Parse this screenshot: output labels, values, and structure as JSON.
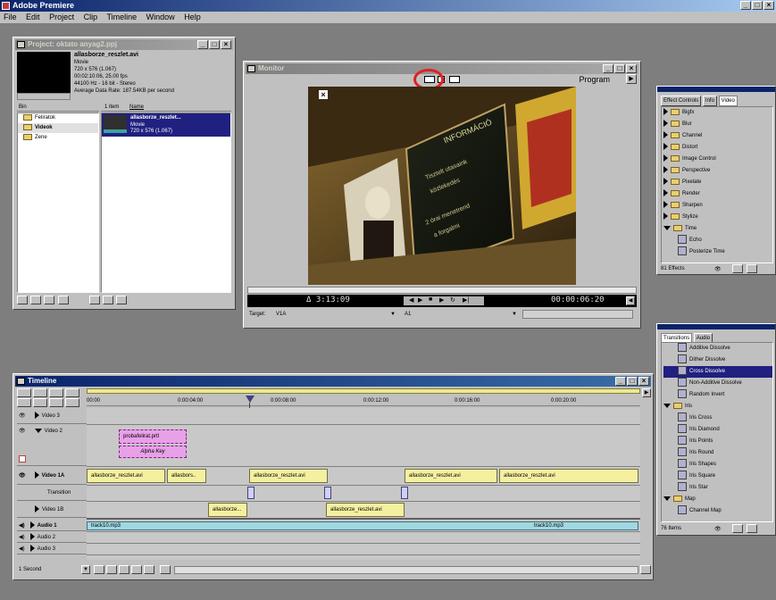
{
  "app": {
    "title": "Adobe Premiere",
    "title_buttons": [
      "_",
      "□",
      "×"
    ]
  },
  "menu": [
    "File",
    "Edit",
    "Project",
    "Clip",
    "Timeline",
    "Window",
    "Help"
  ],
  "project": {
    "title": "Project: oktato anyag2.ppj",
    "preview_name": "allasborze_reszlet.avi",
    "preview_lines": [
      "Movie",
      "720 x 576 (1.067)",
      "00:02:10:06, 25.00 fps",
      "44100 Hz - 16 bit - Stereo",
      "Average Data Rate: 187.54KB per second"
    ],
    "bin_header": "Bin",
    "bins": [
      "Feliratok",
      "Videok",
      "Zene"
    ],
    "items_count": "1 item",
    "name_header": "Name",
    "item_name": "allasborze_reszlet...",
    "item_lines": [
      "Movie",
      "720 x 576 (1.067)"
    ]
  },
  "monitor": {
    "title": "Monitor",
    "program_label": "Program",
    "duration": "Δ 3:13:09",
    "timecode": "00:00:06:20",
    "target_label": "Target:",
    "target_video": "V1A",
    "target_audio": "A1",
    "close_mark": "×",
    "screen_text": [
      "INFORMÁCIÓ",
      "Tisztelt utasaink",
      "közlekedés",
      "2 órai menetrend",
      "a forgalmi"
    ]
  },
  "effects": {
    "tabs": [
      "Effect Controls",
      "Info",
      "Video"
    ],
    "items": [
      {
        "label": "Bigfx",
        "type": "folder"
      },
      {
        "label": "Blur",
        "type": "folder"
      },
      {
        "label": "Channel",
        "type": "folder"
      },
      {
        "label": "Distort",
        "type": "folder"
      },
      {
        "label": "Image Control",
        "type": "folder"
      },
      {
        "label": "Perspective",
        "type": "folder"
      },
      {
        "label": "Pixelate",
        "type": "folder"
      },
      {
        "label": "Render",
        "type": "folder"
      },
      {
        "label": "Sharpen",
        "type": "folder"
      },
      {
        "label": "Stylize",
        "type": "folder"
      },
      {
        "label": "Time",
        "type": "folder-open"
      },
      {
        "label": "Echo",
        "type": "effect"
      },
      {
        "label": "Posterize Time",
        "type": "effect"
      }
    ],
    "count": "81 Effects"
  },
  "transitions": {
    "tabs": [
      "Transitions",
      "Audio"
    ],
    "items": [
      {
        "label": "Additive Dissolve",
        "type": "effect"
      },
      {
        "label": "Dither Dissolve",
        "type": "effect"
      },
      {
        "label": "Cross Dissolve",
        "type": "effect",
        "selected": true
      },
      {
        "label": "Non-Additive Dissolve",
        "type": "effect"
      },
      {
        "label": "Random Invert",
        "type": "effect"
      },
      {
        "label": "Iris",
        "type": "folder-open"
      },
      {
        "label": "Iris Cross",
        "type": "effect"
      },
      {
        "label": "Iris Diamond",
        "type": "effect"
      },
      {
        "label": "Iris Points",
        "type": "effect"
      },
      {
        "label": "Iris Round",
        "type": "effect"
      },
      {
        "label": "Iris Shapes",
        "type": "effect"
      },
      {
        "label": "Iris Square",
        "type": "effect"
      },
      {
        "label": "Iris Star",
        "type": "effect"
      },
      {
        "label": "Map",
        "type": "folder-open"
      },
      {
        "label": "Channel Map",
        "type": "effect"
      }
    ],
    "count": "76 Items"
  },
  "timeline": {
    "title": "Timeline",
    "ruler": [
      "00:00",
      "0:00:04:00",
      "0:00:08:00",
      "0:00:12:00",
      "0:00:16:00",
      "0:00:20:00"
    ],
    "tracks": {
      "video3": "Video 3",
      "video2": "Video 2",
      "video1a": "Video 1A",
      "transition": "Transition",
      "video1b": "Video 1B",
      "audio1": "Audio 1",
      "audio2": "Audio 2",
      "audio3": "Audio 3"
    },
    "clips": {
      "v2_title": "probafelirat.prtl",
      "v2_key": "Alpha Key",
      "v1a": [
        "allasborze_reszlet.avi",
        "allasbors..",
        "allasborze_reszlet.avi",
        "allasborze_reszlet.avi",
        "allasborze_reszlet.avi"
      ],
      "v1b": [
        "allasborze...",
        "allasborze_reszlet.avi"
      ],
      "audio_left": "track10.mp3",
      "audio_right": "track10.mp3"
    },
    "zoom": "1 Second"
  },
  "colors": {
    "highlight_circle": "#e02020",
    "title_active": "#0a246a",
    "clip_video": "#f4f0a0",
    "clip_title": "#e8a0e8",
    "clip_audio": "#a0d8e0",
    "selection": "#202080"
  }
}
